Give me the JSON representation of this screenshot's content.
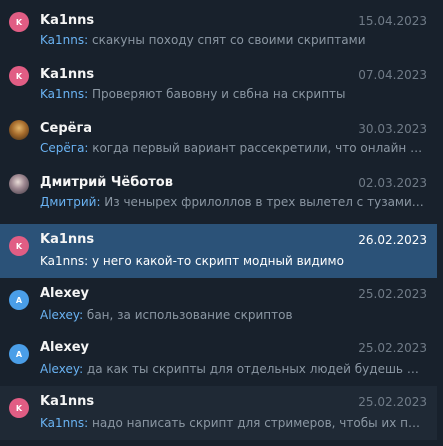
{
  "chats": [
    {
      "avatar": "pink",
      "initial": "K",
      "name": "Ka1nns",
      "date": "15.04.2023",
      "sender": "Ka1nns",
      "sep": ": ",
      "message": "скакуны походу спят со своими скриптами"
    },
    {
      "avatar": "pink",
      "initial": "K",
      "name": "Ka1nns",
      "date": "07.04.2023",
      "sender": "Ka1nns",
      "sep": ": ",
      "message": "Проверяют бавовну и свбна на скрипты"
    },
    {
      "avatar": "photo1",
      "initial": "",
      "name": "Серёга",
      "date": "30.03.2023",
      "sender": "Серёга",
      "sep": ": ",
      "message": "когда первый вариант рассекретили, что онлайн казино"
    },
    {
      "avatar": "photo2",
      "initial": "",
      "name": "Дмитрий Чёботов",
      "date": "02.03.2023",
      "sender": "Дмитрий",
      "sep": ": ",
      "message": "Из ченырех фрилоллов в трех вылетел с тузами, а ..."
    },
    {
      "avatar": "pink",
      "initial": "K",
      "name": "Ka1nns",
      "date": "26.02.2023",
      "sender": "Ka1nns",
      "sep": ": ",
      "message": "у него какой-то скрипт модный видимо"
    },
    {
      "avatar": "blue",
      "initial": "A",
      "name": "Alexey",
      "date": "25.02.2023",
      "sender": "Alexey",
      "sep": ": ",
      "message": "бан, за использование скриптов"
    },
    {
      "avatar": "blue",
      "initial": "A",
      "name": "Alexey",
      "date": "25.02.2023",
      "sender": "Alexey",
      "sep": ": ",
      "message": "да как ты скрипты для отдельных людей будешь писать"
    },
    {
      "avatar": "pink",
      "initial": "K",
      "name": "Ka1nns",
      "date": "25.02.2023",
      "sender": "Ka1nns",
      "sep": ": ",
      "message": "надо написать скрипт для стримеров, чтобы их перебивать"
    }
  ]
}
